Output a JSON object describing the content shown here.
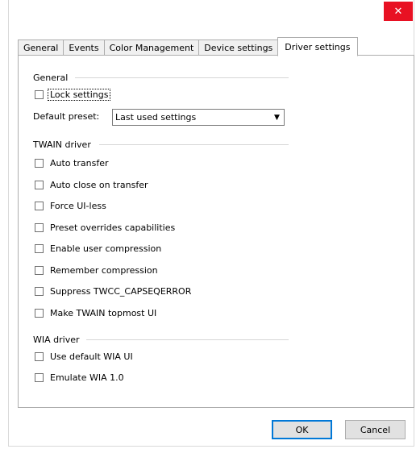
{
  "window": {
    "close_glyph": "✕"
  },
  "tabs": [
    {
      "label": "General"
    },
    {
      "label": "Events"
    },
    {
      "label": "Color Management"
    },
    {
      "label": "Device settings"
    },
    {
      "label": "Driver settings"
    }
  ],
  "general": {
    "title": "General",
    "lock_settings": "Lock settings",
    "preset_label": "Default preset:",
    "preset_value": "Last used settings"
  },
  "twain": {
    "title": "TWAIN driver",
    "options": [
      "Auto transfer",
      "Auto close on transfer",
      "Force UI-less",
      "Preset overrides capabilities",
      "Enable user compression",
      "Remember compression",
      "Suppress TWCC_CAPSEQERROR",
      "Make TWAIN topmost UI"
    ]
  },
  "wia": {
    "title": "WIA driver",
    "options": [
      "Use default WIA UI",
      "Emulate WIA 1.0"
    ]
  },
  "buttons": {
    "ok": "OK",
    "cancel": "Cancel"
  },
  "colors": {
    "close_red": "#e81123",
    "default_border": "#0078d7"
  }
}
